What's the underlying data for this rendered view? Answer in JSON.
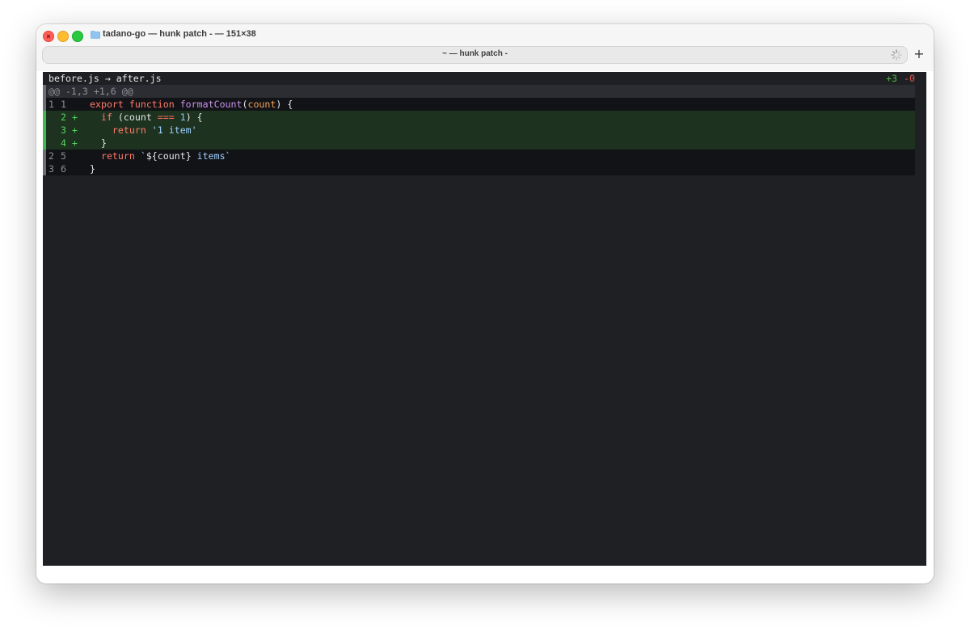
{
  "window": {
    "title": "tadano-go — hunk patch - — 151×38",
    "tab_title": "~ — hunk patch -",
    "new_tab": "+"
  },
  "diff": {
    "header": {
      "before": "before.js",
      "arrow": "→",
      "after": "after.js"
    },
    "stats": {
      "additions": "+3",
      "deletions": "-0"
    },
    "hunk_header": "@@ -1,3 +1,6 @@",
    "lines": [
      {
        "type": "context",
        "old": "1",
        "new": "1",
        "tokens": [
          {
            "c": "k",
            "t": "export"
          },
          {
            "c": "",
            "t": " "
          },
          {
            "c": "k",
            "t": "function"
          },
          {
            "c": "",
            "t": " "
          },
          {
            "c": "f",
            "t": "formatCount"
          },
          {
            "c": "",
            "t": "("
          },
          {
            "c": "p",
            "t": "count"
          },
          {
            "c": "",
            "t": ") {"
          }
        ]
      },
      {
        "type": "add",
        "old": "",
        "new": "2",
        "marker": "+",
        "tokens": [
          {
            "c": "",
            "t": "  "
          },
          {
            "c": "k",
            "t": "if"
          },
          {
            "c": "",
            "t": " (count "
          },
          {
            "c": "op",
            "t": "==="
          },
          {
            "c": "",
            "t": " "
          },
          {
            "c": "n",
            "t": "1"
          },
          {
            "c": "",
            "t": ") {"
          }
        ]
      },
      {
        "type": "add",
        "old": "",
        "new": "3",
        "marker": "+",
        "tokens": [
          {
            "c": "",
            "t": "    "
          },
          {
            "c": "k",
            "t": "return"
          },
          {
            "c": "",
            "t": " "
          },
          {
            "c": "s",
            "t": "'1 item'"
          }
        ]
      },
      {
        "type": "add",
        "old": "",
        "new": "4",
        "marker": "+",
        "tokens": [
          {
            "c": "",
            "t": "  }"
          }
        ]
      },
      {
        "type": "context",
        "old": "2",
        "new": "5",
        "tokens": [
          {
            "c": "",
            "t": "  "
          },
          {
            "c": "k",
            "t": "return"
          },
          {
            "c": "",
            "t": " "
          },
          {
            "c": "s",
            "t": "`"
          },
          {
            "c": "",
            "t": "${count}"
          },
          {
            "c": "s",
            "t": " items`"
          }
        ]
      },
      {
        "type": "context",
        "old": "3",
        "new": "6",
        "tokens": [
          {
            "c": "",
            "t": "}"
          }
        ]
      }
    ]
  },
  "colors": {
    "terminal_bg": "#1e2024",
    "added_bg": "#1d3320",
    "added_gutter": "#3fb950",
    "additions": "#4fb443",
    "deletions": "#e85c4f",
    "keyword": "#ff7a6a",
    "function": "#c792ea",
    "param": "#f0a35b",
    "string": "#9ed0ff"
  },
  "icons": {
    "folder": "folder-icon",
    "spinner": "spinner-icon",
    "close": "close-icon"
  }
}
